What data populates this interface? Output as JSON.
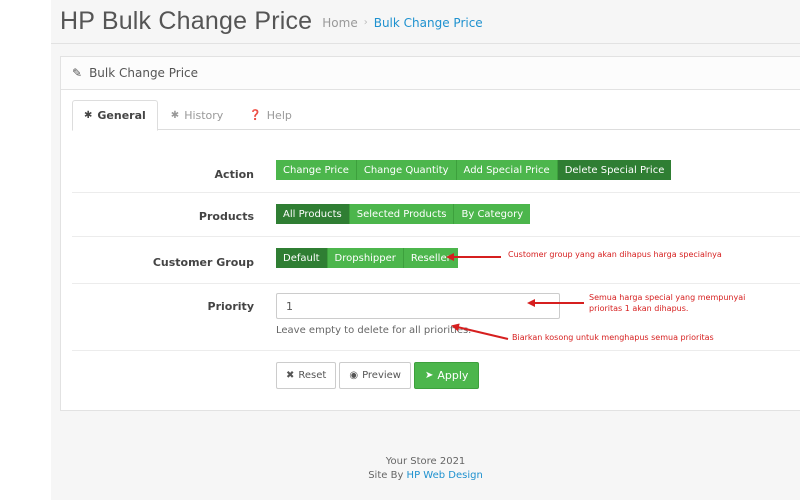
{
  "header": {
    "title": "HP Bulk Change Price",
    "breadcrumb_home": "Home",
    "breadcrumb_sep": "›",
    "breadcrumb_current": "Bulk Change Price"
  },
  "panel": {
    "title": "Bulk Change Price"
  },
  "tabs": [
    {
      "label": "General",
      "active": true
    },
    {
      "label": "History",
      "active": false
    },
    {
      "label": "Help",
      "active": false
    }
  ],
  "action": {
    "label": "Action",
    "options": [
      "Change Price",
      "Change Quantity",
      "Add Special Price",
      "Delete Special Price"
    ],
    "selected": "Delete Special Price"
  },
  "products": {
    "label": "Products",
    "options": [
      "All Products",
      "Selected Products",
      "By Category"
    ],
    "selected": "All Products"
  },
  "customer_group": {
    "label": "Customer Group",
    "options": [
      "Default",
      "Dropshipper",
      "Reseller"
    ],
    "selected": "Default"
  },
  "priority": {
    "label": "Priority",
    "value": "1",
    "help": "Leave empty to delete for all priorities."
  },
  "buttons": {
    "reset": "Reset",
    "preview": "Preview",
    "apply": "Apply"
  },
  "annotations": {
    "customer_group": "Customer group yang akan dihapus harga specialnya",
    "priority_line1": "Semua harga special yang mempunyai",
    "priority_line2": "prioritas 1 akan dihapus.",
    "help": "Biarkan kosong untuk menghapus semua prioritas",
    "color": "#d61f1f"
  },
  "footer": {
    "line1": "Your Store 2021",
    "site_by": "Site By",
    "link": "HP Web Design"
  },
  "colors": {
    "green": "#4cb64c",
    "green_selected": "#2f7e33",
    "link": "#1e91cf"
  }
}
